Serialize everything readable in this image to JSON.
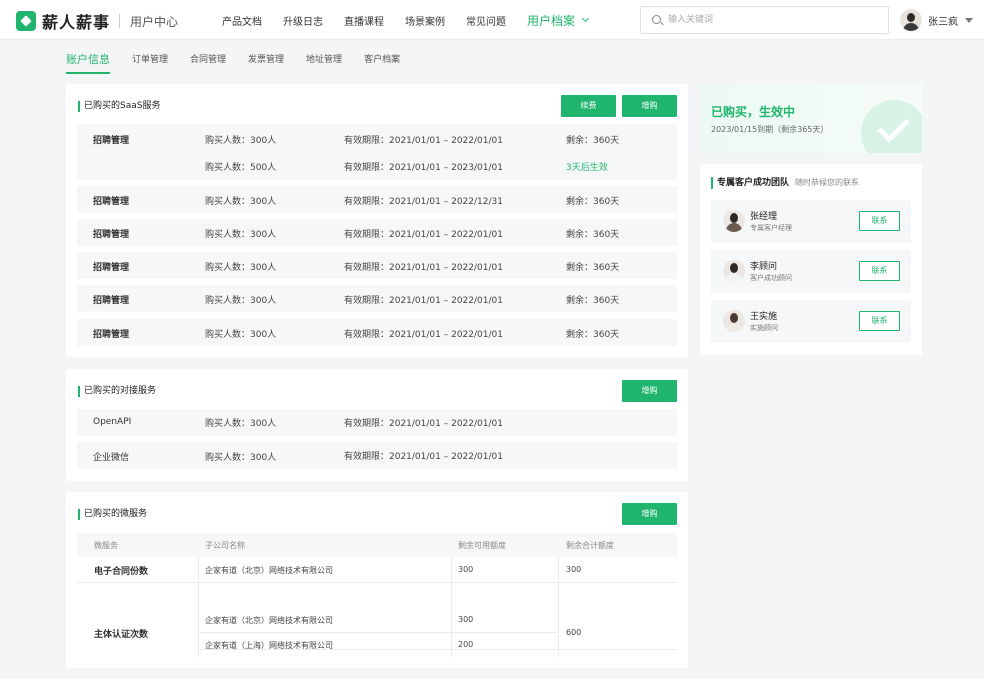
{
  "brand": {
    "name": "薪人薪事",
    "section": "用户中心"
  },
  "nav": {
    "items": [
      "产品文档",
      "升级日志",
      "直播课程",
      "场景案例",
      "常见问题"
    ],
    "active": "用户档案"
  },
  "search": {
    "placeholder": "输入关键词"
  },
  "user": {
    "name": "张三疯"
  },
  "tabs": [
    "账户信息",
    "订单管理",
    "合同管理",
    "发票管理",
    "地址管理",
    "客户档案"
  ],
  "saas": {
    "title": "已购买的SaaS服务",
    "renew_label": "续费",
    "add_label": "增购",
    "group": {
      "name": "招聘管理",
      "lines": [
        {
          "buy": "购买人数：300人",
          "valid": "有效期限：2021/01/01 – 2022/01/01",
          "remain": "剩余：360天"
        },
        {
          "buy": "购买人数：500人",
          "valid": "有效期限：2021/01/01 – 2023/01/01",
          "remain": "3天后生效"
        }
      ]
    },
    "rows": [
      {
        "name": "招聘管理",
        "buy": "购买人数：300人",
        "valid": "有效期限：2021/01/01 – 2022/12/31",
        "remain": "剩余：360天"
      },
      {
        "name": "招聘管理",
        "buy": "购买人数：300人",
        "valid": "有效期限：2021/01/01 – 2022/01/01",
        "remain": "剩余：360天"
      },
      {
        "name": "招聘管理",
        "buy": "购买人数：300人",
        "valid": "有效期限：2021/01/01 – 2022/01/01",
        "remain": "剩余：360天"
      },
      {
        "name": "招聘管理",
        "buy": "购买人数：300人",
        "valid": "有效期限：2021/01/01 – 2022/01/01",
        "remain": "剩余：360天"
      },
      {
        "name": "招聘管理",
        "buy": "购买人数：300人",
        "valid": "有效期限：2021/01/01 – 2022/01/01",
        "remain": "剩余：360天"
      }
    ]
  },
  "integration": {
    "title": "已购买的对接服务",
    "add_label": "增购",
    "rows": [
      {
        "name": "OpenAPI",
        "buy": "购买人数：300人",
        "valid": "有效期限：2021/01/01 – 2022/01/01"
      },
      {
        "name": "企业微信",
        "buy": "购买人数：300人",
        "valid": "有效期限：2021/01/01 – 2022/01/01"
      }
    ]
  },
  "micro": {
    "title": "已购买的微服务",
    "add_label": "增购",
    "headers": [
      "微服务",
      "子公司名称",
      "剩余可用额度",
      "剩余合计额度"
    ],
    "row1": {
      "name": "电子合同份数",
      "company": "企家有道（北京）网络技术有限公司",
      "available": "300",
      "total": "300"
    },
    "row2": {
      "name": "主体认证次数",
      "company_a": "企家有道（北京）网络技术有限公司",
      "available_a": "300",
      "company_b": "企家有道（上海）网络技术有限公司",
      "available_b": "200",
      "total": "600"
    }
  },
  "promo": {
    "title": "已购买，生效中",
    "subtitle": "2023/01/15到期（剩余365天）"
  },
  "team": {
    "title": "专属客户成功团队",
    "subtitle": "随时恭候您的联系",
    "contact_label": "联系",
    "members": [
      {
        "name": "张经理",
        "role": "专属客户经理"
      },
      {
        "name": "李顾问",
        "role": "客户成功顾问"
      },
      {
        "name": "王实施",
        "role": "实施顾问"
      }
    ]
  },
  "colors": {
    "accent": "#20b56e",
    "background": "#f4f5f7",
    "row_bg": "#f6f7f8"
  }
}
